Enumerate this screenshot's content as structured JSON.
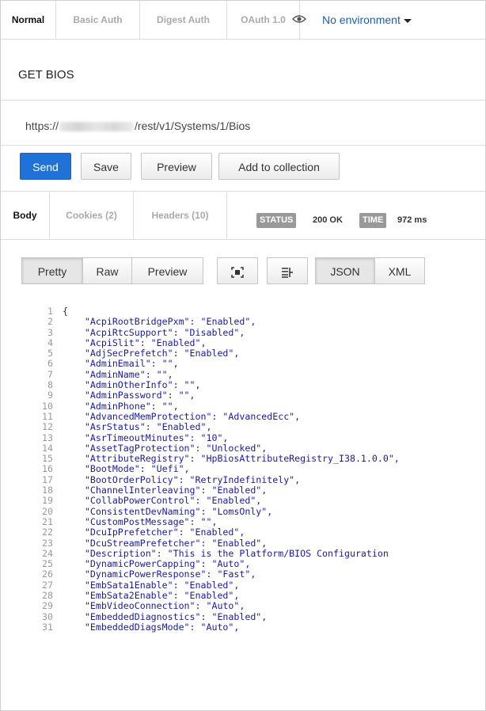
{
  "auth_tabs": [
    "Normal",
    "Basic Auth",
    "Digest Auth",
    "OAuth 1.0"
  ],
  "environment": {
    "label": "No environment",
    "icon": "eye-icon"
  },
  "request": {
    "title": "GET BIOS",
    "url_prefix": "https://",
    "url_suffix": "/rest/v1/Systems/1/Bios"
  },
  "actions": {
    "send": "Send",
    "save": "Save",
    "preview": "Preview",
    "add": "Add to collection"
  },
  "response_tabs": [
    "Body",
    "Cookies (2)",
    "Headers (10)"
  ],
  "status": {
    "status_label": "STATUS",
    "status_value": "200 OK",
    "time_label": "TIME",
    "time_value": "972 ms"
  },
  "view_toolbar": {
    "pretty": "Pretty",
    "raw": "Raw",
    "preview": "Preview",
    "json": "JSON",
    "xml": "XML"
  },
  "code_lines": [
    "{",
    "    \"AcpiRootBridgePxm\": \"Enabled\",",
    "    \"AcpiRtcSupport\": \"Disabled\",",
    "    \"AcpiSlit\": \"Enabled\",",
    "    \"AdjSecPrefetch\": \"Enabled\",",
    "    \"AdminEmail\": \"\",",
    "    \"AdminName\": \"\",",
    "    \"AdminOtherInfo\": \"\",",
    "    \"AdminPassword\": \"\",",
    "    \"AdminPhone\": \"\",",
    "    \"AdvancedMemProtection\": \"AdvancedEcc\",",
    "    \"AsrStatus\": \"Enabled\",",
    "    \"AsrTimeoutMinutes\": \"10\",",
    "    \"AssetTagProtection\": \"Unlocked\",",
    "    \"AttributeRegistry\": \"HpBiosAttributeRegistry_I38.1.0.0\",",
    "    \"BootMode\": \"Uefi\",",
    "    \"BootOrderPolicy\": \"RetryIndefinitely\",",
    "    \"ChannelInterleaving\": \"Enabled\",",
    "    \"CollabPowerControl\": \"Enabled\",",
    "    \"ConsistentDevNaming\": \"LomsOnly\",",
    "    \"CustomPostMessage\": \"\",",
    "    \"DcuIpPrefetcher\": \"Enabled\",",
    "    \"DcuStreamPrefetcher\": \"Enabled\",",
    "    \"Description\": \"This is the Platform/BIOS Configuration",
    "    \"DynamicPowerCapping\": \"Auto\",",
    "    \"DynamicPowerResponse\": \"Fast\",",
    "    \"EmbSata1Enable\": \"Enabled\",",
    "    \"EmbSata2Enable\": \"Enabled\",",
    "    \"EmbVideoConnection\": \"Auto\",",
    "    \"EmbeddedDiagnostics\": \"Enabled\",",
    "    \"EmbeddedDiagsMode\": \"Auto\","
  ]
}
